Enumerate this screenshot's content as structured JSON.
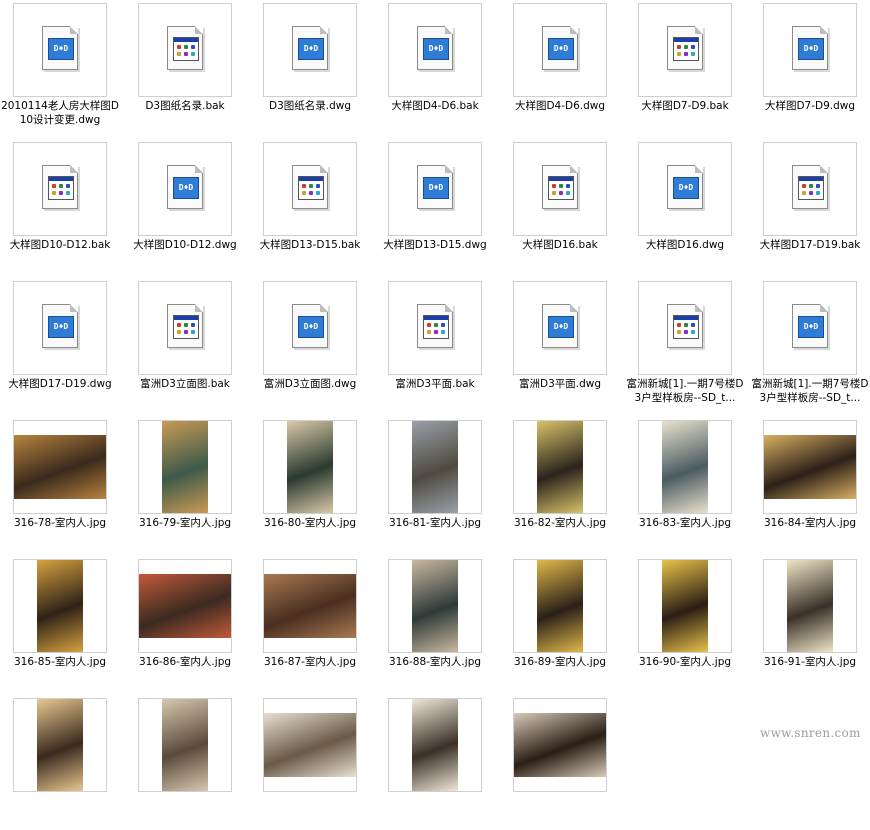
{
  "files": [
    {
      "name": "2010114老人房大样图D10设计变更.dwg",
      "kind": "dwg"
    },
    {
      "name": "D3图纸名录.bak",
      "kind": "bak"
    },
    {
      "name": "D3图纸名录.dwg",
      "kind": "dwg"
    },
    {
      "name": "大样图D4-D6.bak",
      "kind": "dwg"
    },
    {
      "name": "大样图D4-D6.dwg",
      "kind": "dwg"
    },
    {
      "name": "大样图D7-D9.bak",
      "kind": "bak"
    },
    {
      "name": "大样图D7-D9.dwg",
      "kind": "dwg"
    },
    {
      "name": "大样图D10-D12.bak",
      "kind": "bak"
    },
    {
      "name": "大样图D10-D12.dwg",
      "kind": "dwg"
    },
    {
      "name": "大样图D13-D15.bak",
      "kind": "bak"
    },
    {
      "name": "大样图D13-D15.dwg",
      "kind": "dwg"
    },
    {
      "name": "大样图D16.bak",
      "kind": "bak"
    },
    {
      "name": "大样图D16.dwg",
      "kind": "dwg"
    },
    {
      "name": "大样图D17-D19.bak",
      "kind": "bak"
    },
    {
      "name": "大样图D17-D19.dwg",
      "kind": "dwg"
    },
    {
      "name": "富洲D3立面图.bak",
      "kind": "bak"
    },
    {
      "name": "富洲D3立面图.dwg",
      "kind": "dwg"
    },
    {
      "name": "富洲D3平面.bak",
      "kind": "bak"
    },
    {
      "name": "富洲D3平面.dwg",
      "kind": "dwg"
    },
    {
      "name": "富洲新城[1].一期7号楼D3户型样板房--SD_t...",
      "kind": "bak"
    },
    {
      "name": "富洲新城[1].一期7号楼D3户型样板房--SD_t...",
      "kind": "dwg"
    },
    {
      "name": "316-78-室内人.jpg",
      "kind": "jpg",
      "photo": "landscape",
      "c1": "#3a2a1c",
      "c2": "#b8833f"
    },
    {
      "name": "316-79-室内人.jpg",
      "kind": "jpg",
      "photo": "portrait",
      "c1": "#3d5a4a",
      "c2": "#c99a55"
    },
    {
      "name": "316-80-室内人.jpg",
      "kind": "jpg",
      "photo": "portrait",
      "c1": "#2a3a30",
      "c2": "#d9c9a8"
    },
    {
      "name": "316-81-室内人.jpg",
      "kind": "jpg",
      "photo": "portrait",
      "c1": "#4e4a40",
      "c2": "#9aa0a8"
    },
    {
      "name": "316-82-室内人.jpg",
      "kind": "jpg",
      "photo": "portrait",
      "c1": "#2b241c",
      "c2": "#d8c26a"
    },
    {
      "name": "316-83-室内人.jpg",
      "kind": "jpg",
      "photo": "portrait",
      "c1": "#4a5b60",
      "c2": "#e9e2cf"
    },
    {
      "name": "316-84-室内人.jpg",
      "kind": "jpg",
      "photo": "landscape",
      "c1": "#2c2018",
      "c2": "#d9b063"
    },
    {
      "name": "316-85-室内人.jpg",
      "kind": "jpg",
      "photo": "portrait",
      "c1": "#2e2218",
      "c2": "#d6a23e"
    },
    {
      "name": "316-86-室内人.jpg",
      "kind": "jpg",
      "photo": "landscape",
      "c1": "#3b2a20",
      "c2": "#c25a3a"
    },
    {
      "name": "316-87-室内人.jpg",
      "kind": "jpg",
      "photo": "landscape",
      "c1": "#4a2e20",
      "c2": "#a87a52"
    },
    {
      "name": "316-88-室内人.jpg",
      "kind": "jpg",
      "photo": "portrait",
      "c1": "#2e3a38",
      "c2": "#c9b8a0"
    },
    {
      "name": "316-89-室内人.jpg",
      "kind": "jpg",
      "photo": "portrait",
      "c1": "#2a2018",
      "c2": "#e0b84a"
    },
    {
      "name": "316-90-室内人.jpg",
      "kind": "jpg",
      "photo": "portrait",
      "c1": "#2b1e14",
      "c2": "#e8c24a"
    },
    {
      "name": "316-91-室内人.jpg",
      "kind": "jpg",
      "photo": "portrait",
      "c1": "#3a3028",
      "c2": "#efe6c8"
    },
    {
      "name": "",
      "kind": "jpg",
      "photo": "portrait",
      "c1": "#3a2a1e",
      "c2": "#e8c890"
    },
    {
      "name": "",
      "kind": "jpg",
      "photo": "portrait",
      "c1": "#5a4a3a",
      "c2": "#d8c8b0"
    },
    {
      "name": "",
      "kind": "jpg",
      "photo": "landscape",
      "c1": "#6a5a48",
      "c2": "#e8e0d0"
    },
    {
      "name": "",
      "kind": "jpg",
      "photo": "portrait",
      "c1": "#3a3028",
      "c2": "#f0e8d8"
    },
    {
      "name": "",
      "kind": "jpg",
      "photo": "landscape",
      "c1": "#2a1e16",
      "c2": "#d8cbb8"
    }
  ],
  "watermark": "www.snren.com"
}
